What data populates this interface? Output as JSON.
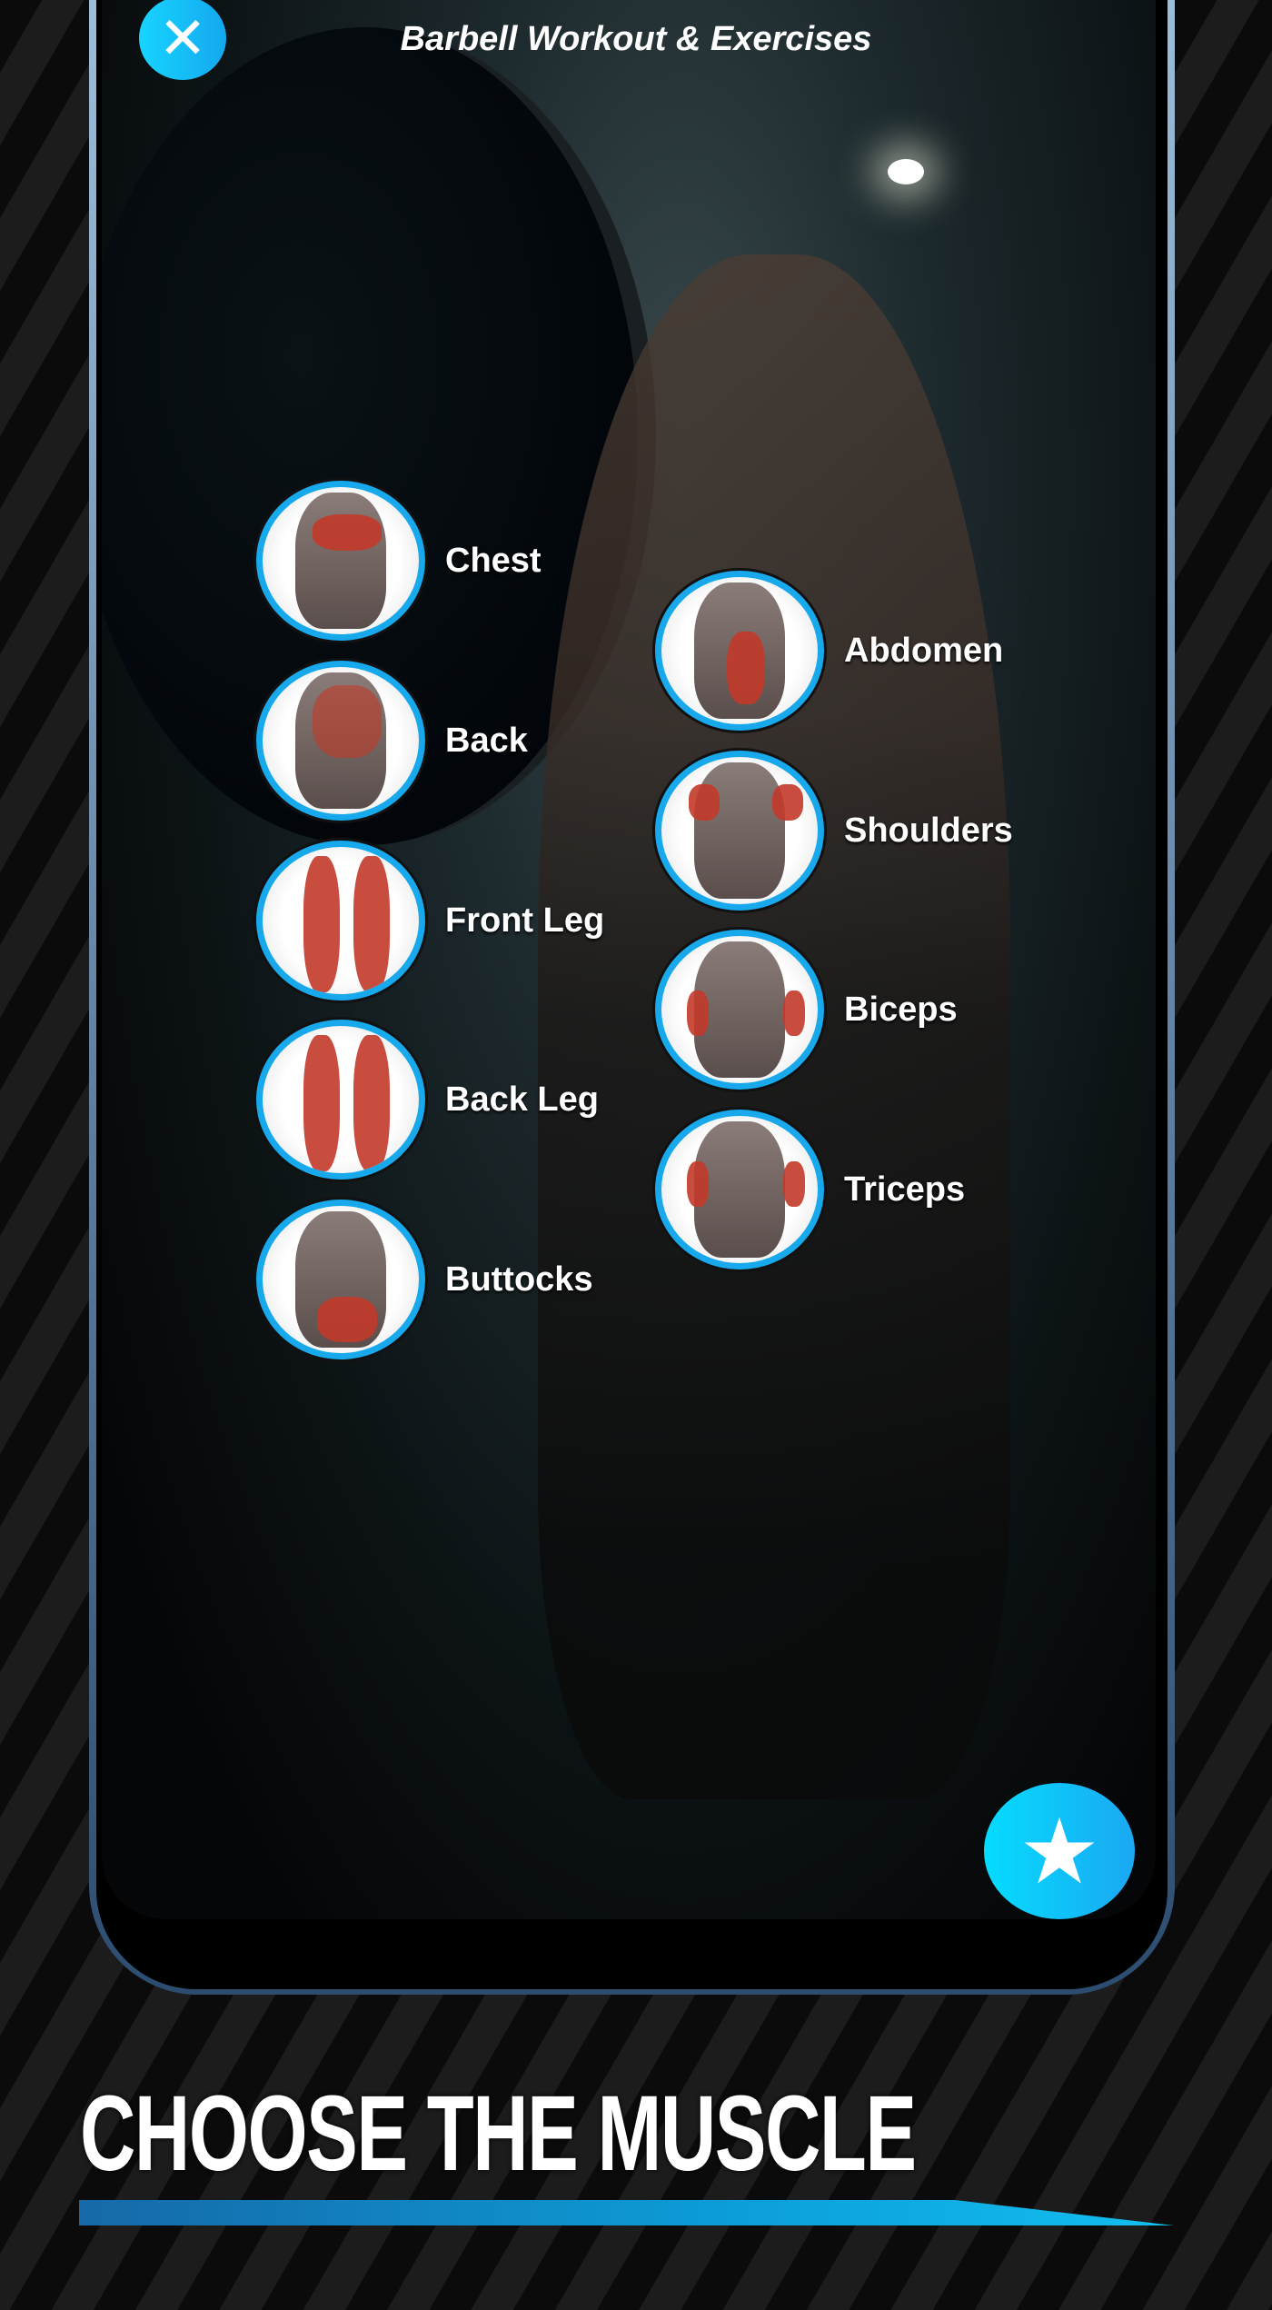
{
  "header": {
    "title": "Barbell Workout & Exercises",
    "close_icon": "close-icon"
  },
  "muscles": {
    "left": [
      {
        "label": "Chest",
        "highlight": "chest"
      },
      {
        "label": "Back",
        "highlight": "upper-back"
      },
      {
        "label": "Front Leg",
        "highlight": "quads"
      },
      {
        "label": "Back Leg",
        "highlight": "hamstrings"
      },
      {
        "label": "Buttocks",
        "highlight": "glutes"
      }
    ],
    "right": [
      {
        "label": "Abdomen",
        "highlight": "abs"
      },
      {
        "label": "Shoulders",
        "highlight": "deltoids"
      },
      {
        "label": "Biceps",
        "highlight": "biceps"
      },
      {
        "label": "Triceps",
        "highlight": "triceps"
      }
    ]
  },
  "fab": {
    "icon": "star-icon"
  },
  "promo": {
    "headline": "CHOOSE THE MUSCLE"
  },
  "colors": {
    "accent": "#18a8ec",
    "highlight": "#c23a2a"
  }
}
